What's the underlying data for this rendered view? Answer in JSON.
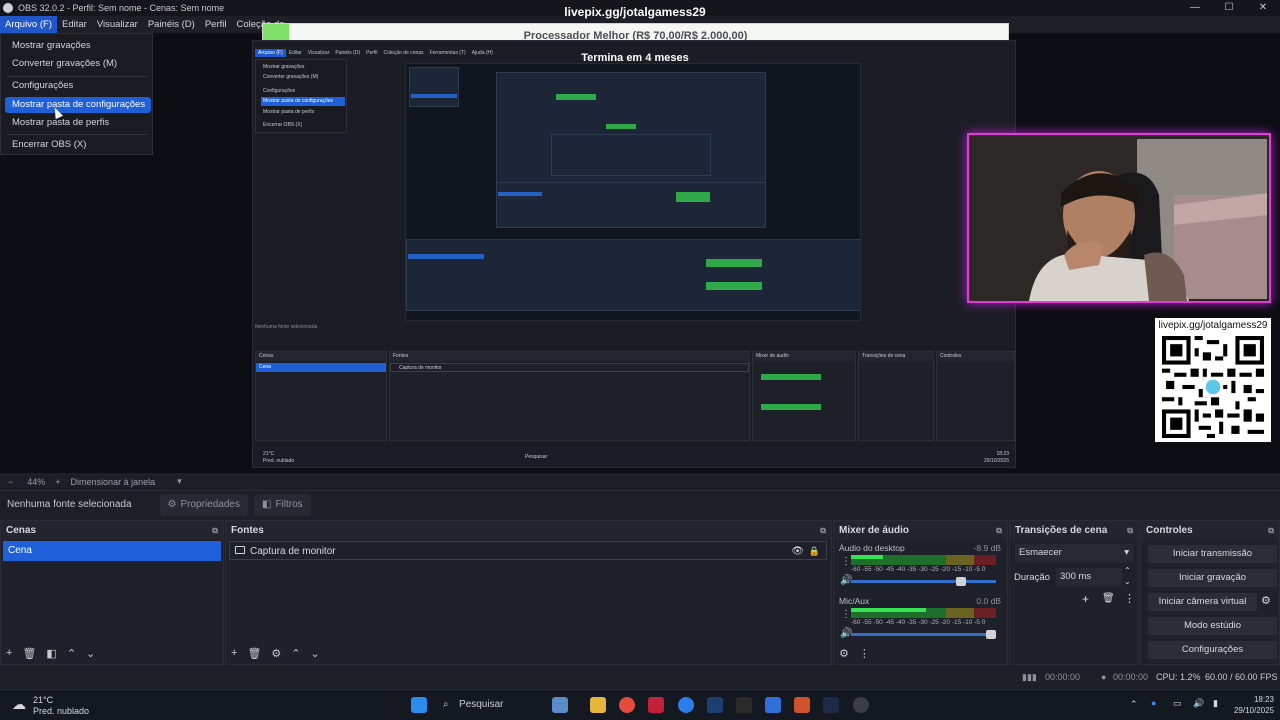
{
  "window": {
    "title": "OBS 32.0.2 - Perfil: Sem nome - Cenas: Sem nome",
    "controls": [
      "—",
      "☐",
      "✕"
    ]
  },
  "menubar": [
    "Arquivo (F)",
    "Editar",
    "Visualizar",
    "Painéis (D)",
    "Perfil",
    "Coleção de"
  ],
  "file_menu": {
    "items": [
      "Mostrar gravações",
      "Converter gravações (M)",
      "Configurações",
      "Mostrar pasta de configurações",
      "Mostrar pasta de perfis",
      "Encerrar OBS (X)"
    ],
    "active_index": 3
  },
  "overlay": {
    "stream_title": "livepix.gg/jotalgamess29",
    "goal_text": "Processador Melhor (R$ 70,00/R$ 2.000,00)",
    "goal_progress": 0.035,
    "goal_sub": "Termina em 4 meses",
    "qr_label": "livepix.gg/jotalgamess29"
  },
  "nested": {
    "menubar": [
      "Arquivo (F)",
      "Editar",
      "Visualizar",
      "Painéis (D)",
      "Perfil",
      "Coleção de cenas",
      "Ferramentas (T)",
      "Ajuda (H)"
    ],
    "menu_items": [
      "Mostrar gravações",
      "Converter gravações (M)",
      "Configurações",
      "Mostrar pasta de configurações",
      "Mostrar pasta de perfis",
      "Encerrar OBS (X)"
    ],
    "status": "Nenhuma fonte selecionada",
    "panels": [
      "Cenas",
      "Fontes",
      "Mixer de áudio",
      "Transições de cena",
      "Controles"
    ],
    "scene": "Cena",
    "source": "Captura de monitor",
    "weather": "21°C",
    "weather_sub": "Pred. nublado",
    "search": "Pesquisar",
    "time": "18:23",
    "date": "29/10/2025"
  },
  "zoom_bar": {
    "minus": "−",
    "zoom": "44%",
    "plus": "+",
    "mode": "Dimensionar à janela"
  },
  "source_bar": {
    "status": "Nenhuma fonte selecionada",
    "properties": "Propriedades",
    "filters": "Filtros"
  },
  "scenes": {
    "title": "Cenas",
    "items": [
      "Cena"
    ]
  },
  "sources": {
    "title": "Fontes",
    "items": [
      "Captura de monitor"
    ]
  },
  "mixer": {
    "title": "Mixer de áudio",
    "channels": [
      {
        "name": "Áudio do desktop",
        "db": "-8.9 dB",
        "level": 0.22,
        "volume": 0.78
      },
      {
        "name": "Mic/Aux",
        "db": "0.0 dB",
        "level": 0.52,
        "volume": 1.0
      }
    ],
    "ticks": "-60 -55 -50 -45 -40 -35 -30 -25 -20 -15 -10 -5 0"
  },
  "transitions": {
    "title": "Transições de cena",
    "selected": "Esmaecer",
    "duration_label": "Duração",
    "duration_value": "300 ms"
  },
  "controls": {
    "title": "Controles",
    "buttons": [
      "Iniciar transmissão",
      "Iniciar gravação",
      "Iniciar câmera virtual",
      "Modo estúdio",
      "Configurações"
    ]
  },
  "statusbar": {
    "rec_time": "00:00:00",
    "stream_time": "00:00:00",
    "cpu": "CPU: 1.2%",
    "fps": "60.00 / 60.00 FPS"
  },
  "taskbar": {
    "weather_temp": "21°C",
    "weather_desc": "Pred. nublado",
    "search": "Pesquisar",
    "time": "18:23",
    "date": "29/10/2025",
    "colors": {
      "accent": "#1f5fd8",
      "meter_green": "#35e455"
    }
  }
}
